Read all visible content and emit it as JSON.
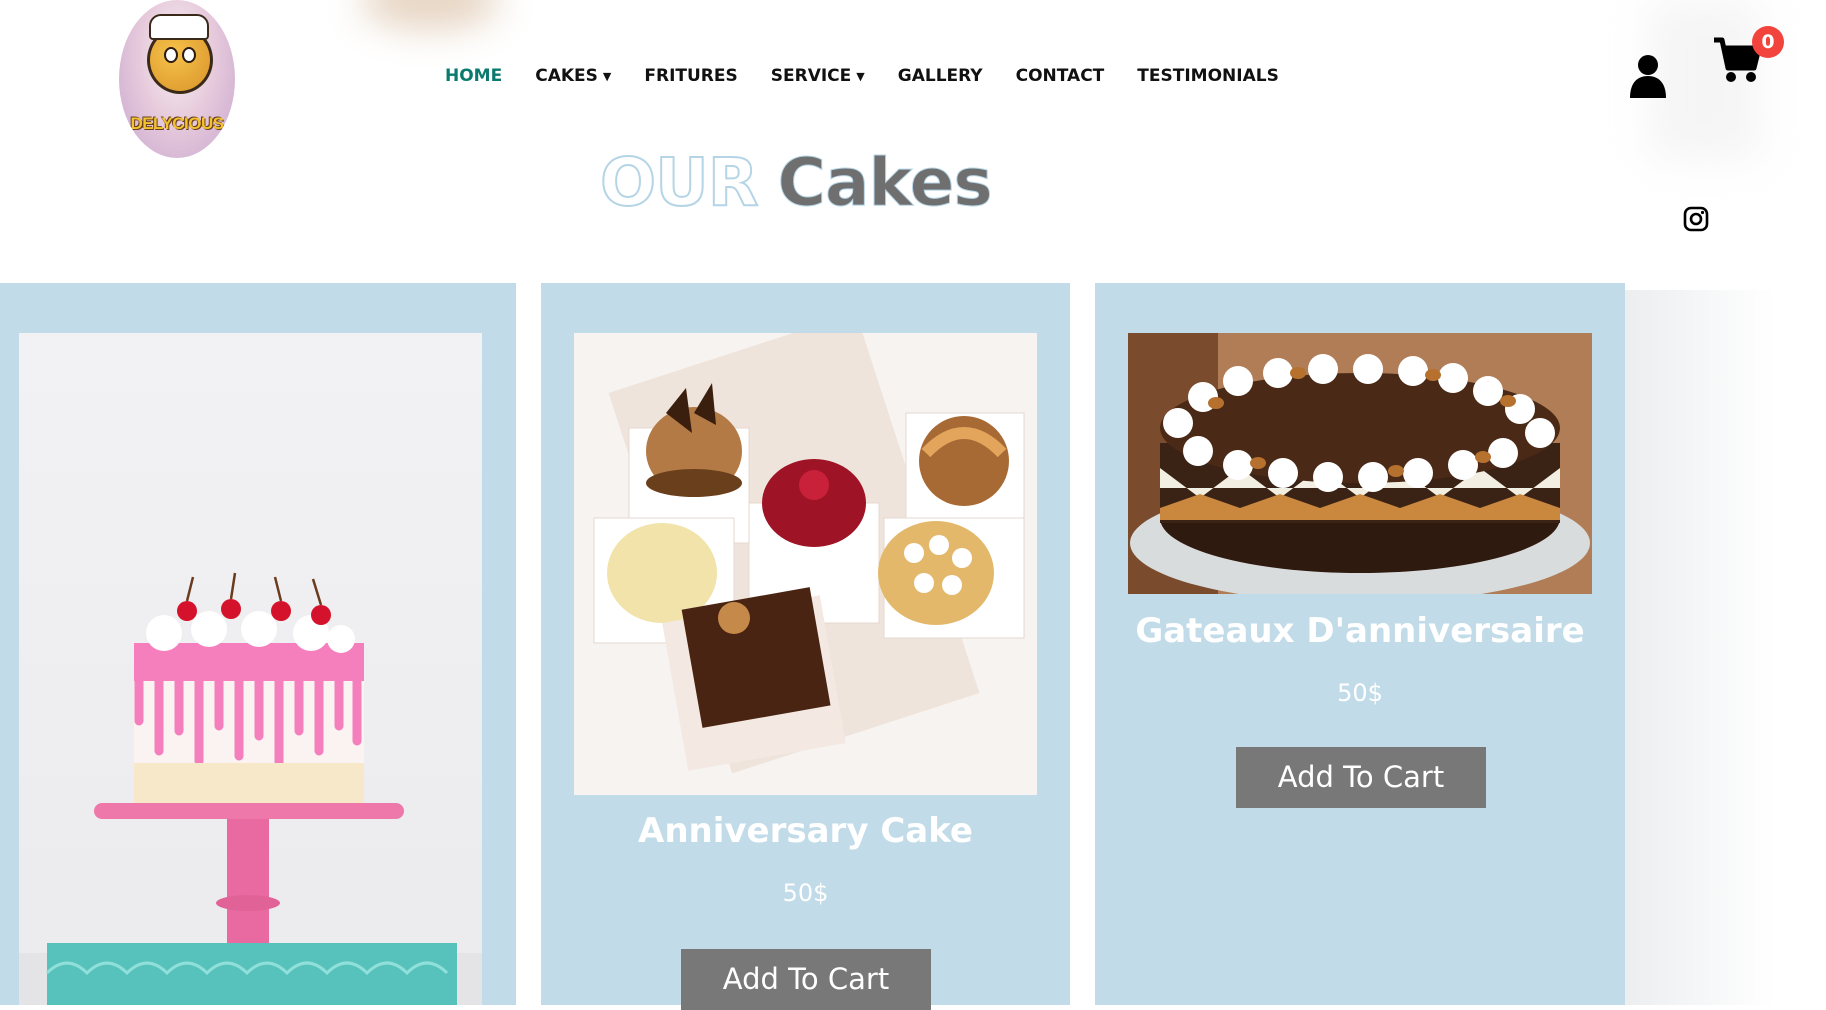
{
  "brand": {
    "logo_text": "DELYCIOUS"
  },
  "nav": {
    "items": [
      {
        "label": "HOME",
        "active": true
      },
      {
        "label": "CAKES",
        "dropdown": true
      },
      {
        "label": "FRITURES"
      },
      {
        "label": "SERVICE",
        "dropdown": true
      },
      {
        "label": "GALLERY"
      },
      {
        "label": "CONTACT"
      },
      {
        "label": "TESTIMONIALS"
      }
    ]
  },
  "header_icons": {
    "user": "user-icon",
    "cart": "shopping-cart-icon",
    "cart_count": "0",
    "instagram": "instagram-icon"
  },
  "page_title": {
    "word1": "OUR",
    "word2": "Cakes"
  },
  "products": [
    {
      "name": "",
      "price": "",
      "button": "",
      "image": "pink drip cake on stand"
    },
    {
      "name": "Anniversary Cake",
      "price": "50$",
      "button": "Add To Cart",
      "image": "assorted pastries"
    },
    {
      "name": "Gateaux D'anniversaire",
      "price": "50$",
      "button": "Add To Cart",
      "image": "chocolate cream cake"
    }
  ],
  "colors": {
    "card_bg": "#c2dbe8",
    "active_nav": "#0a7a6e",
    "button_bg": "#787878",
    "badge": "#f2443d"
  }
}
